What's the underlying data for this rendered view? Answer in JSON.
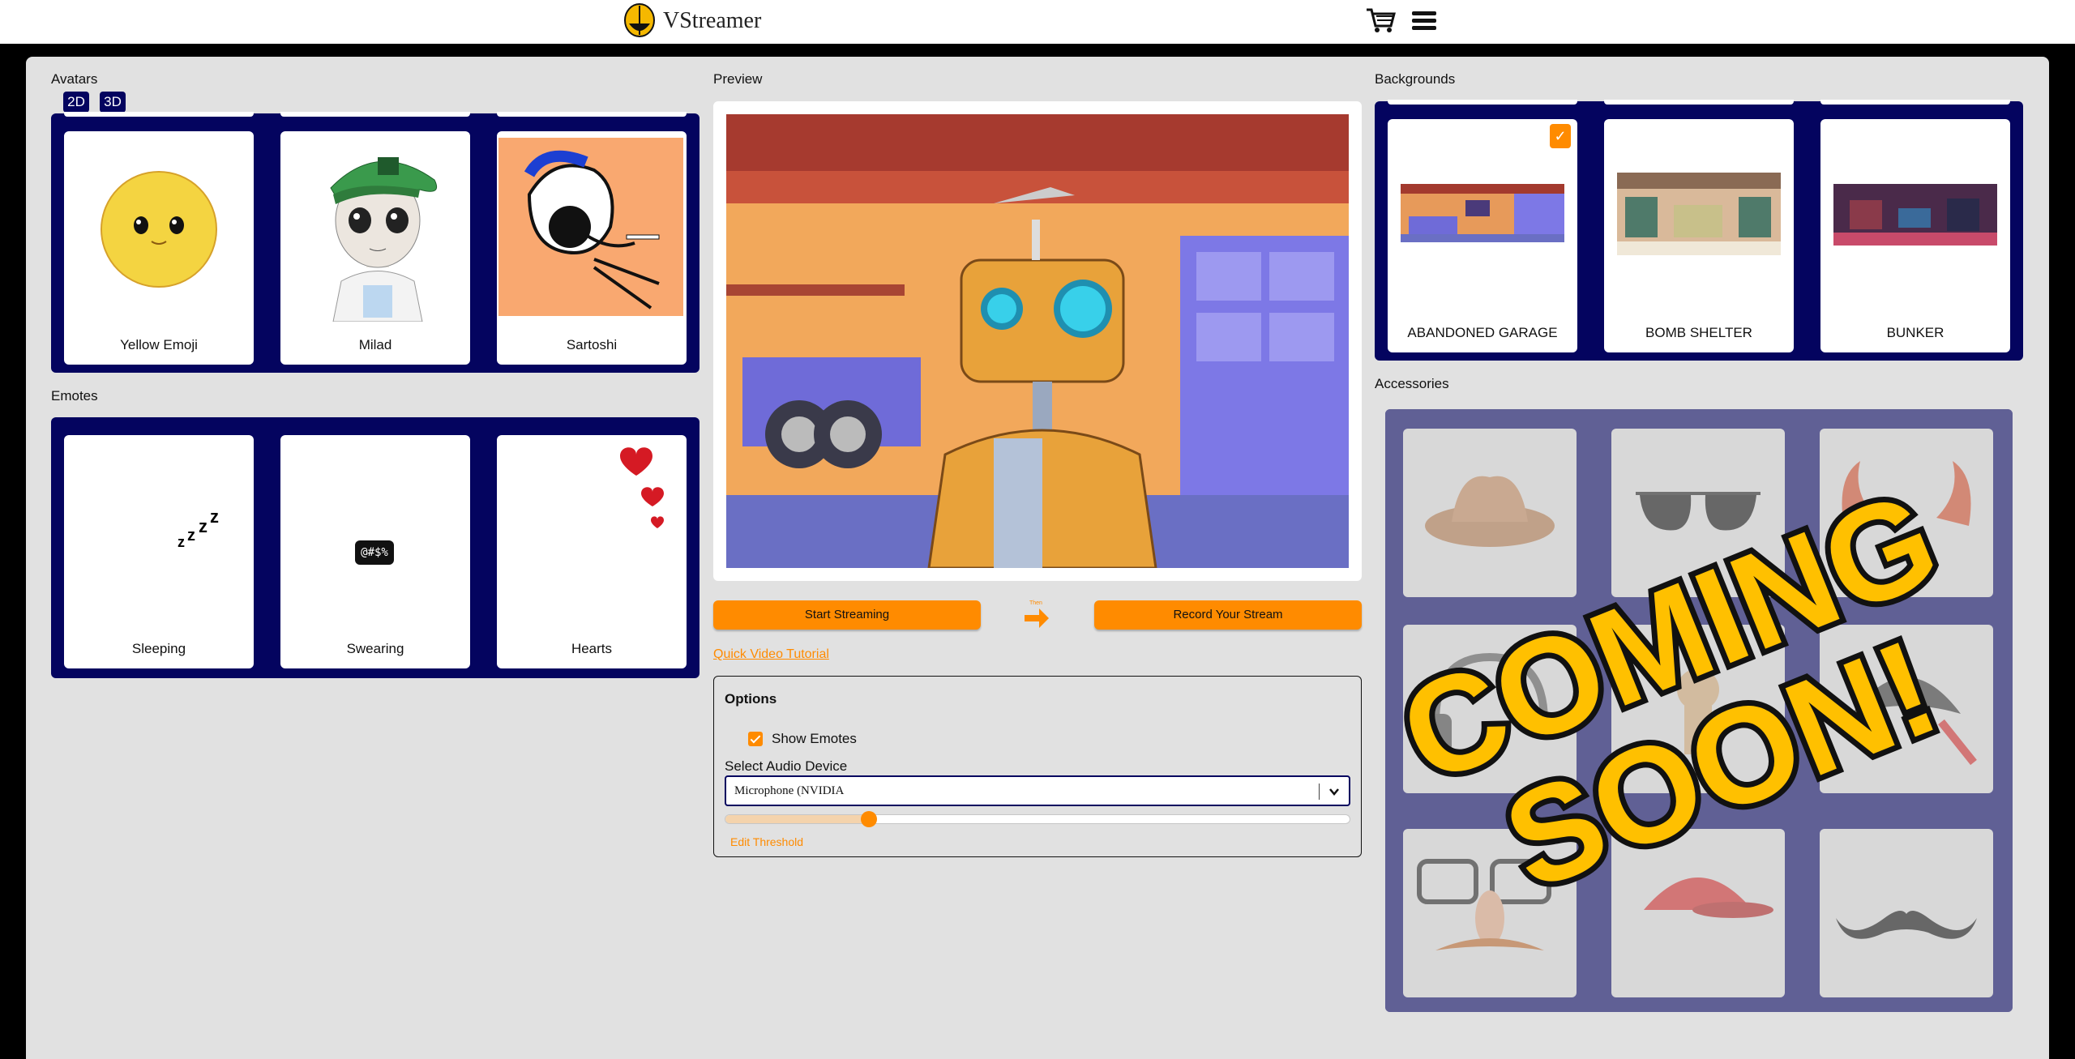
{
  "header": {
    "brand": "VStreamer",
    "logo_icon": "helmet-logo-icon",
    "cart_icon": "cart-icon",
    "menu_icon": "hamburger-menu-icon"
  },
  "avatars": {
    "label": "Avatars",
    "tabs": [
      "2D",
      "3D"
    ],
    "items": [
      {
        "name": "Yellow Emoji"
      },
      {
        "name": "Milad"
      },
      {
        "name": "Sartoshi"
      }
    ]
  },
  "emotes": {
    "label": "Emotes",
    "items": [
      {
        "name": "Sleeping"
      },
      {
        "name": "Swearing",
        "glyph": "@#$%"
      },
      {
        "name": "Hearts"
      }
    ]
  },
  "preview": {
    "label": "Preview",
    "start_button": "Start Streaming",
    "arrow_caption": "Then",
    "record_button": "Record Your Stream",
    "tutorial_link": "Quick Video Tutorial"
  },
  "options": {
    "title": "Options",
    "show_emotes_label": "Show Emotes",
    "show_emotes_checked": true,
    "audio_label": "Select Audio Device",
    "audio_device": "Microphone (NVIDIA",
    "threshold_level": 0.23,
    "edit_threshold": "Edit Threshold"
  },
  "backgrounds": {
    "label": "Backgrounds",
    "items": [
      {
        "name": "ABANDONED GARAGE",
        "selected": true
      },
      {
        "name": "BOMB SHELTER",
        "selected": false
      },
      {
        "name": "BUNKER",
        "selected": false
      }
    ]
  },
  "accessories": {
    "label": "Accessories",
    "overlay_line1": "COMING",
    "overlay_line2": "SOON!",
    "items": [
      "cowboy-hat-icon",
      "sunglasses-icon",
      "devil-horns-icon",
      "headphones-icon",
      "voodoo-doll-icon",
      "pirate-hat-icon",
      "groucho-glasses-icon",
      "red-cap-icon",
      "mustache-icon"
    ]
  },
  "colors": {
    "accent": "#ff8b00",
    "panel": "#04045f",
    "page": "#e1e1e1"
  }
}
